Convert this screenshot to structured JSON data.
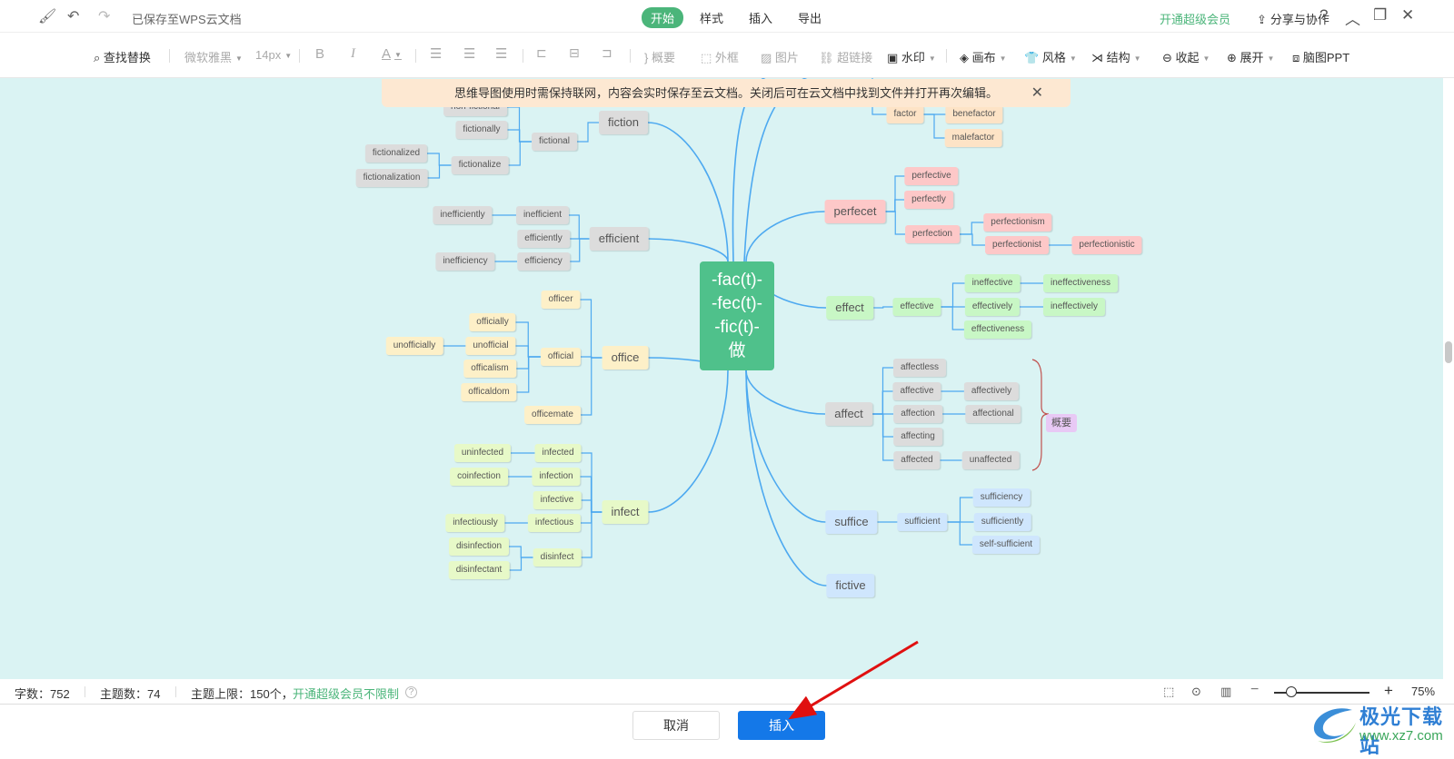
{
  "titlebar": {
    "doc_status": "已保存至WPS云文档",
    "tabs": [
      "开始",
      "样式",
      "插入",
      "导出"
    ],
    "active_tab": "开始",
    "vip_link": "开通超级会员",
    "share_label": "分享与协作",
    "icons": {
      "format_painter": "🖌",
      "undo": "↶",
      "redo": "↷",
      "help": "?",
      "collapse": "︿",
      "restore": "❐",
      "close": "✕"
    }
  },
  "toolbar": {
    "find_replace": "查找替换",
    "font_family": "微软雅黑",
    "font_size": "14px",
    "bold": "B",
    "italic": "I",
    "font_color": "A",
    "summary": "概要",
    "outer_frame": "外框",
    "image": "图片",
    "hyperlink": "超链接",
    "watermark": "水印",
    "canvas": "画布",
    "style": "风格",
    "structure": "结构",
    "collapse": "收起",
    "expand": "展开",
    "mindmap_ppt": "脑图PPT"
  },
  "notice": {
    "text": "思维导图使用时需保持联网，内容会实时保存至云文档。关闭后可在云文档中找到文件并打开再次编辑。",
    "close": "✕"
  },
  "mindmap": {
    "root": [
      "-fac(t)-",
      "-fec(t)-",
      "-fic(t)-",
      "做"
    ],
    "summary_label": "概要",
    "colors": {
      "link": "#4da9f0",
      "root": "#4fc18b",
      "summary_brace": "#c0504d"
    },
    "nodes": [
      {
        "id": "fiction",
        "text": "fiction",
        "level": 1,
        "color": "gray"
      },
      {
        "id": "fictional",
        "text": "fictional",
        "parent": "fiction",
        "color": "gray"
      },
      {
        "id": "non-fictional",
        "text": "non-fictional",
        "parent": "fictional",
        "color": "gray"
      },
      {
        "id": "fictionally",
        "text": "fictionally",
        "parent": "fictional",
        "color": "gray"
      },
      {
        "id": "fictionalize",
        "text": "fictionalize",
        "parent": "fictional",
        "color": "gray"
      },
      {
        "id": "fictionalized",
        "text": "fictionalized",
        "parent": "fictionalize",
        "color": "gray"
      },
      {
        "id": "fictionalization",
        "text": "fictionalization",
        "parent": "fictionalize",
        "color": "gray"
      },
      {
        "id": "efficient",
        "text": "efficient",
        "level": 1,
        "color": "gray"
      },
      {
        "id": "inefficient",
        "text": "inefficient",
        "parent": "efficient",
        "color": "gray"
      },
      {
        "id": "efficiently",
        "text": "efficiently",
        "parent": "efficient",
        "color": "gray"
      },
      {
        "id": "efficiency",
        "text": "efficiency",
        "parent": "efficient",
        "color": "gray"
      },
      {
        "id": "inefficiently",
        "text": "inefficiently",
        "parent": "inefficient",
        "color": "gray"
      },
      {
        "id": "inefficiency",
        "text": "inefficiency",
        "parent": "efficiency",
        "color": "gray"
      },
      {
        "id": "office",
        "text": "office",
        "level": 1,
        "color": "yellow"
      },
      {
        "id": "officer",
        "text": "officer",
        "parent": "office",
        "color": "yellow"
      },
      {
        "id": "official",
        "text": "official",
        "parent": "office",
        "color": "yellow"
      },
      {
        "id": "officemate",
        "text": "officemate",
        "parent": "office",
        "color": "yellow"
      },
      {
        "id": "officially",
        "text": "officially",
        "parent": "official",
        "color": "yellow"
      },
      {
        "id": "unofficial",
        "text": "unofficial",
        "parent": "official",
        "color": "yellow"
      },
      {
        "id": "officalism",
        "text": "officalism",
        "parent": "official",
        "color": "yellow"
      },
      {
        "id": "officaldom",
        "text": "officaldom",
        "parent": "official",
        "color": "yellow"
      },
      {
        "id": "unofficially",
        "text": "unofficially",
        "parent": "unofficial",
        "color": "yellow"
      },
      {
        "id": "infect",
        "text": "infect",
        "level": 1,
        "color": "lime"
      },
      {
        "id": "infected",
        "text": "infected",
        "parent": "infect",
        "color": "lime"
      },
      {
        "id": "infection",
        "text": "infection",
        "parent": "infect",
        "color": "lime"
      },
      {
        "id": "infective",
        "text": "infective",
        "parent": "infect",
        "color": "lime"
      },
      {
        "id": "infectious",
        "text": "infectious",
        "parent": "infect",
        "color": "lime"
      },
      {
        "id": "disinfect",
        "text": "disinfect",
        "parent": "infect",
        "color": "lime"
      },
      {
        "id": "uninfected",
        "text": "uninfected",
        "parent": "infected",
        "color": "lime"
      },
      {
        "id": "coinfection",
        "text": "coinfection",
        "parent": "infection",
        "color": "lime"
      },
      {
        "id": "infectiously",
        "text": "infectiously",
        "parent": "infectious",
        "color": "lime"
      },
      {
        "id": "disinfection",
        "text": "disinfection",
        "parent": "disinfect",
        "color": "lime"
      },
      {
        "id": "disinfectant",
        "text": "disinfectant",
        "parent": "disinfect",
        "color": "lime"
      },
      {
        "id": "factor",
        "text": "factor",
        "color": "orange"
      },
      {
        "id": "benefactor",
        "text": "benefactor",
        "parent": "factor",
        "color": "orange"
      },
      {
        "id": "malefactor",
        "text": "malefactor",
        "parent": "factor",
        "color": "orange"
      },
      {
        "id": "perfecet",
        "text": "perfecet",
        "level": 1,
        "color": "pink"
      },
      {
        "id": "perfective",
        "text": "perfective",
        "parent": "perfecet",
        "color": "pink"
      },
      {
        "id": "perfectly",
        "text": "perfectly",
        "parent": "perfecet",
        "color": "pink"
      },
      {
        "id": "perfection",
        "text": "perfection",
        "parent": "perfecet",
        "color": "pink"
      },
      {
        "id": "perfectionism",
        "text": "perfectionism",
        "parent": "perfection",
        "color": "pink"
      },
      {
        "id": "perfectionist",
        "text": "perfectionist",
        "parent": "perfection",
        "color": "pink"
      },
      {
        "id": "perfectionistic",
        "text": "perfectionistic",
        "parent": "perfectionist",
        "color": "pink"
      },
      {
        "id": "effect",
        "text": "effect",
        "level": 1,
        "color": "green"
      },
      {
        "id": "effective",
        "text": "effective",
        "parent": "effect",
        "color": "green"
      },
      {
        "id": "ineffective",
        "text": "ineffective",
        "parent": "effective",
        "color": "green"
      },
      {
        "id": "effectively",
        "text": "effectively",
        "parent": "effective",
        "color": "green"
      },
      {
        "id": "effectiveness",
        "text": "effectiveness",
        "parent": "effective",
        "color": "green"
      },
      {
        "id": "ineffectiveness",
        "text": "ineffectiveness",
        "parent": "ineffective",
        "color": "green"
      },
      {
        "id": "ineffectively",
        "text": "ineffectively",
        "parent": "effectively",
        "color": "green"
      },
      {
        "id": "affect",
        "text": "affect",
        "level": 1,
        "color": "gray"
      },
      {
        "id": "affectless",
        "text": "affectless",
        "parent": "affect",
        "color": "gray"
      },
      {
        "id": "affective",
        "text": "affective",
        "parent": "affect",
        "color": "gray"
      },
      {
        "id": "affection",
        "text": "affection",
        "parent": "affect",
        "color": "gray"
      },
      {
        "id": "affecting",
        "text": "affecting",
        "parent": "affect",
        "color": "gray"
      },
      {
        "id": "affected",
        "text": "affected",
        "parent": "affect",
        "color": "gray"
      },
      {
        "id": "affectively",
        "text": "affectively",
        "parent": "affective",
        "color": "gray"
      },
      {
        "id": "affectional",
        "text": "affectional",
        "parent": "affection",
        "color": "gray"
      },
      {
        "id": "unaffected",
        "text": "unaffected",
        "parent": "affected",
        "color": "gray"
      },
      {
        "id": "suffice",
        "text": "suffice",
        "level": 1,
        "color": "blue"
      },
      {
        "id": "sufficient",
        "text": "sufficient",
        "parent": "suffice",
        "color": "blue"
      },
      {
        "id": "sufficiency",
        "text": "sufficiency",
        "parent": "sufficient",
        "color": "blue"
      },
      {
        "id": "sufficiently",
        "text": "sufficiently",
        "parent": "sufficient",
        "color": "blue"
      },
      {
        "id": "self-sufficient",
        "text": "self-sufficient",
        "parent": "sufficient",
        "color": "blue"
      },
      {
        "id": "fictive",
        "text": "fictive",
        "level": 1,
        "color": "blue"
      }
    ]
  },
  "statusbar": {
    "word_count": "字数：752",
    "topic_count": "主题数：74",
    "topic_limit": "主题上限：150个，",
    "vip_unlimited": "开通超级会员不限制",
    "help": "?",
    "zoom_value": "75%",
    "zoom_fraction": 0.18
  },
  "footer": {
    "cancel": "取消",
    "insert": "插入"
  },
  "watermark": {
    "title": "极光下载站",
    "url": "www.xz7.com"
  }
}
